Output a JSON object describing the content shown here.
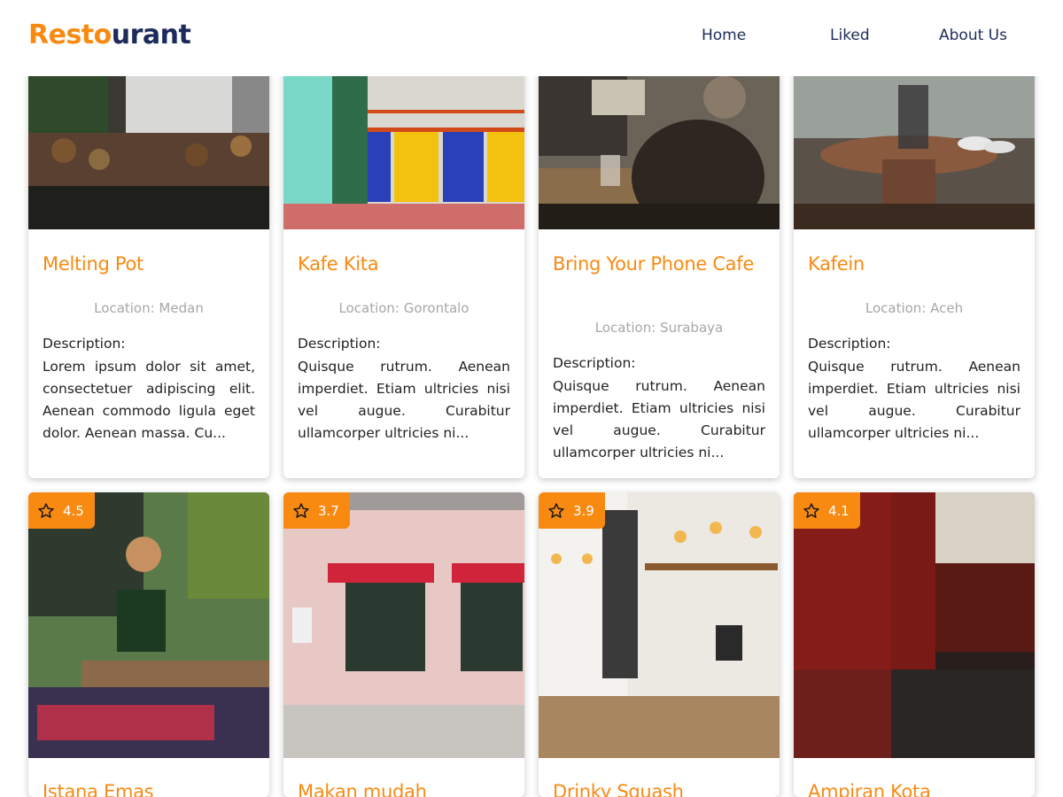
{
  "brand": {
    "part1": "Resto",
    "part2": "urant"
  },
  "nav": [
    {
      "label": "Home"
    },
    {
      "label": "Liked"
    },
    {
      "label": "About Us"
    }
  ],
  "colors": {
    "accent": "#f88a12",
    "navy": "#1d2b5a",
    "location": "#a7a7a7"
  },
  "restaurants_top": [
    {
      "name": "Melting Pot",
      "location": "Location: Medan",
      "desc_label": "Description:",
      "description": "Lorem ipsum dolor sit amet, consectetuer adipiscing elit. Aenean commodo ligula eget dolor. Aenean massa. Cu..."
    },
    {
      "name": "Kafe Kita",
      "location": "Location: Gorontalo",
      "desc_label": "Description:",
      "description": "Quisque rutrum. Aenean imperdiet. Etiam ultricies nisi vel augue. Curabitur ullamcorper ultricies ni..."
    },
    {
      "name": "Bring Your Phone Cafe",
      "location": "Location: Surabaya",
      "desc_label": "Description:",
      "description": "Quisque rutrum. Aenean imperdiet. Etiam ultricies nisi vel augue. Curabitur ullamcorper ultricies ni..."
    },
    {
      "name": "Kafein",
      "location": "Location: Aceh",
      "desc_label": "Description:",
      "description": "Quisque rutrum. Aenean imperdiet. Etiam ultricies nisi vel augue. Curabitur ullamcorper ultricies ni..."
    }
  ],
  "restaurants_bottom": [
    {
      "name": "Istana Emas",
      "rating": "4.5",
      "rating_icon": "star-icon"
    },
    {
      "name": "Makan mudah",
      "rating": "3.7",
      "rating_icon": "star-icon"
    },
    {
      "name": "Drinky Squash",
      "rating": "3.9",
      "rating_icon": "star-icon"
    },
    {
      "name": "Ampiran Kota",
      "rating": "4.1",
      "rating_icon": "star-icon"
    }
  ]
}
